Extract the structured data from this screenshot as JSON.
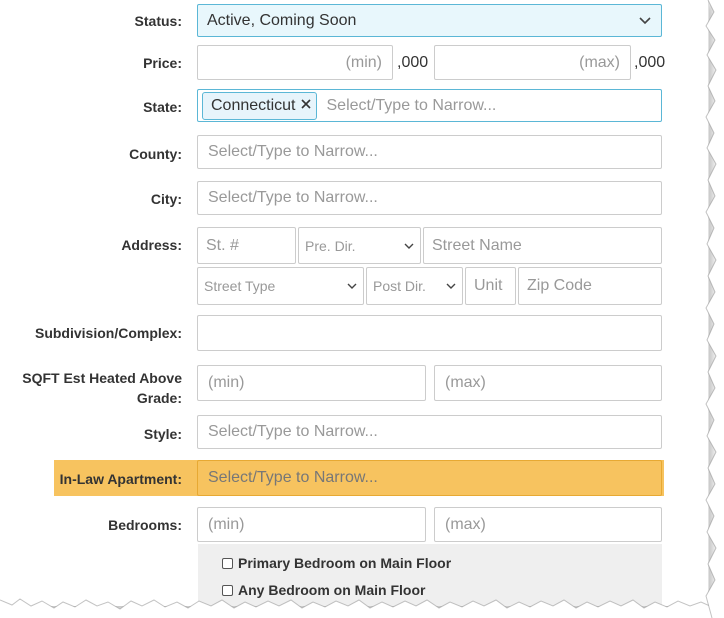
{
  "status": {
    "label": "Status:",
    "value": "Active, Coming Soon"
  },
  "price": {
    "label": "Price:",
    "min_placeholder": "(min)",
    "max_placeholder": "(max)",
    "suffix_min": ",000",
    "suffix_max": ",000"
  },
  "state": {
    "label": "State:",
    "tag": "Connecticut",
    "placeholder": "Select/Type to Narrow..."
  },
  "county": {
    "label": "County:",
    "placeholder": "Select/Type to Narrow..."
  },
  "city": {
    "label": "City:",
    "placeholder": "Select/Type to Narrow..."
  },
  "address": {
    "label": "Address:",
    "street_num": "St. #",
    "pre_dir": "Pre. Dir.",
    "street_name": "Street Name",
    "street_type": "Street Type",
    "post_dir": "Post Dir.",
    "unit": "Unit",
    "zip": "Zip Code"
  },
  "subdivision": {
    "label": "Subdivision/Complex:"
  },
  "sqft": {
    "label_line1": "SQFT Est Heated Above",
    "label_line2": "Grade:",
    "min_placeholder": "(min)",
    "max_placeholder": "(max)"
  },
  "style": {
    "label": "Style:",
    "placeholder": "Select/Type to Narrow..."
  },
  "inlaw": {
    "label": "In-Law Apartment:",
    "placeholder": "Select/Type to Narrow..."
  },
  "bedrooms": {
    "label": "Bedrooms:",
    "min_placeholder": "(min)",
    "max_placeholder": "(max)",
    "checkbox_primary": "Primary Bedroom on Main Floor",
    "checkbox_any": "Any Bedroom on Main Floor"
  },
  "icons": {
    "dropdown": "chevron-down-icon",
    "remove": "close-icon"
  },
  "colors": {
    "status_bg": "#e8f7fc",
    "status_border": "#5bb7d6",
    "highlight": "#f7c35f"
  }
}
